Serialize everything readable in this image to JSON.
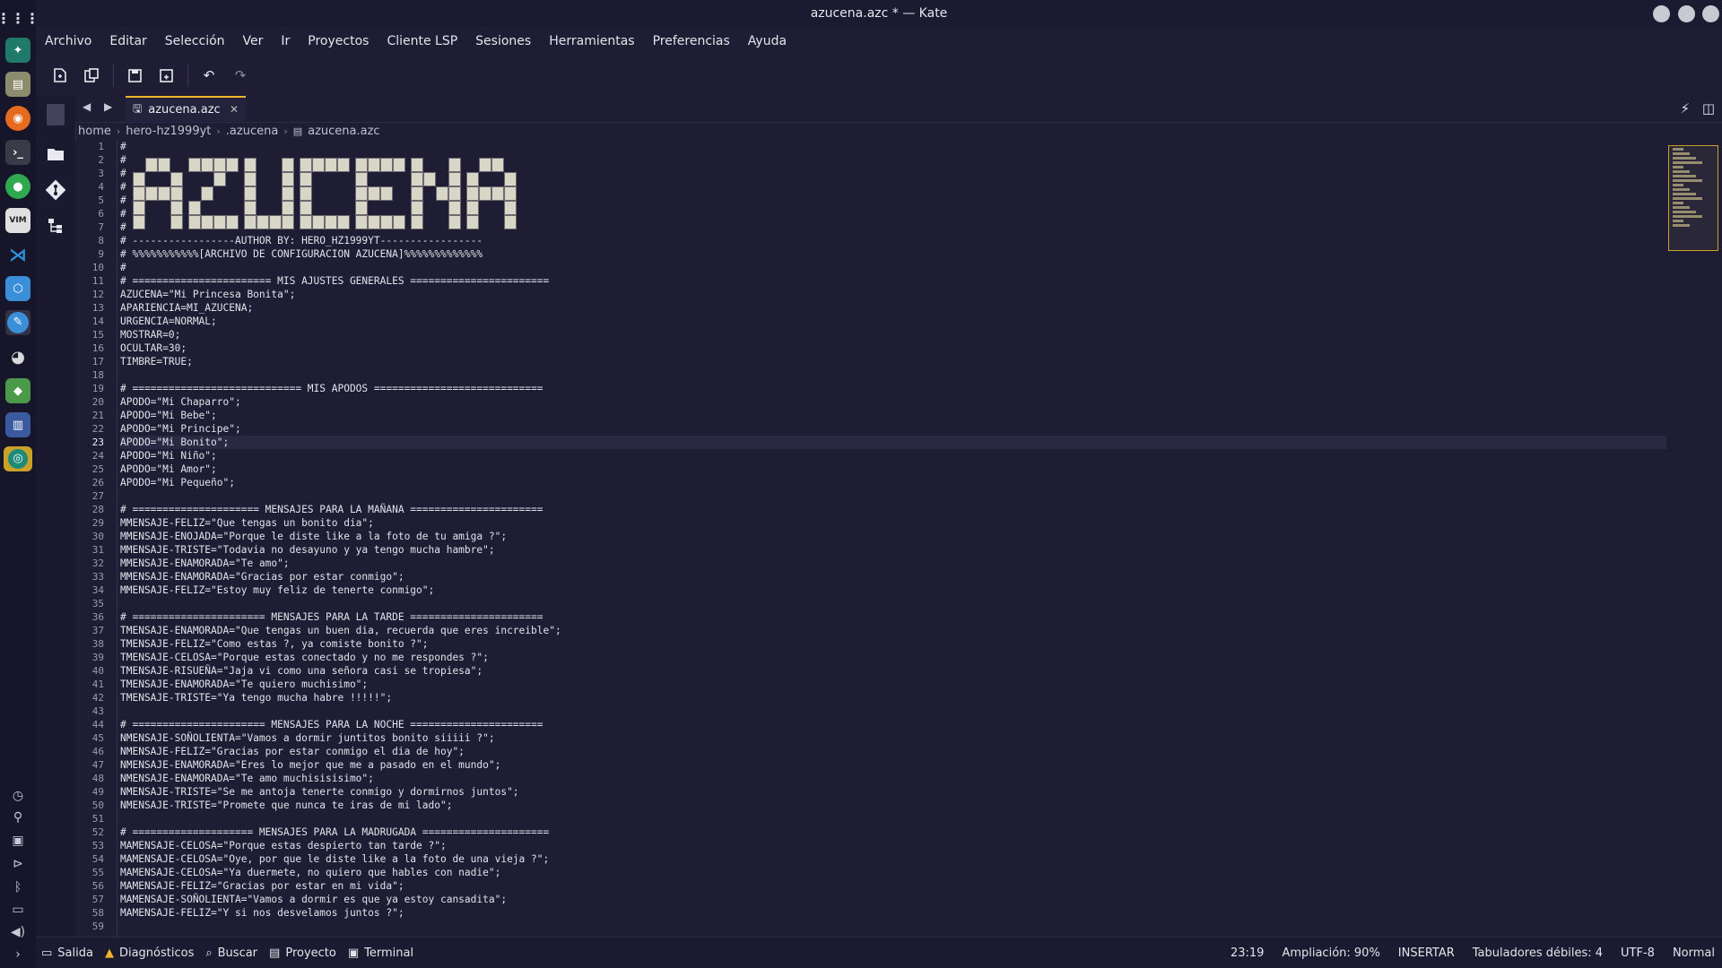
{
  "window": {
    "title": "azucena.azc * — Kate"
  },
  "menu": [
    "Archivo",
    "Editar",
    "Selección",
    "Ver",
    "Ir",
    "Proyectos",
    "Cliente LSP",
    "Sesiones",
    "Herramientas",
    "Preferencias",
    "Ayuda"
  ],
  "tab": {
    "label": "azucena.azc"
  },
  "breadcrumb": [
    "home",
    "hero-hz1999yt",
    ".azucena",
    "azucena.azc"
  ],
  "editor": {
    "current_line": 23,
    "ascii_art_word": "AZUCENA",
    "lines": [
      "#",
      "#",
      "#",
      "#",
      "#",
      "#",
      "#",
      "# -----------------AUTHOR BY: HERO_HZ1999YT-----------------",
      "# %%%%%%%%%%%[ARCHIVO DE CONFIGURACION AZUCENA]%%%%%%%%%%%%%",
      "#",
      "# ======================= MIS AJUSTES GENERALES =======================",
      "AZUCENA=\"Mi Princesa Bonita\";",
      "APARIENCIA=MI_AZUCENA;",
      "URGENCIA=NORMAL;",
      "MOSTRAR=0;",
      "OCULTAR=30;",
      "TIMBRE=TRUE;",
      "",
      "# ============================ MIS APODOS ============================",
      "APODO=\"Mi Chaparro\";",
      "APODO=\"Mi Bebe\";",
      "APODO=\"Mi Principe\";",
      "APODO=\"Mi Bonito\";",
      "APODO=\"Mi Niño\";",
      "APODO=\"Mi Amor\";",
      "APODO=\"Mi Pequeño\";",
      "",
      "# ===================== MENSAJES PARA LA MAÑANA ======================",
      "MMENSAJE-FELIZ=\"Que tengas un bonito dia\";",
      "MMENSAJE-ENOJADA=\"Porque le diste like a la foto de tu amiga ?\";",
      "MMENSAJE-TRISTE=\"Todavia no desayuno y ya tengo mucha hambre\";",
      "MMENSAJE-ENAMORADA=\"Te amo\";",
      "MMENSAJE-ENAMORADA=\"Gracias por estar conmigo\";",
      "MMENSAJE-FELIZ=\"Estoy muy feliz de tenerte conmigo\";",
      "",
      "# ====================== MENSAJES PARA LA TARDE ======================",
      "TMENSAJE-ENAMORADA=\"Que tengas un buen dia, recuerda que eres increible\";",
      "TMENSAJE-FELIZ=\"Como estas ?, ya comiste bonito ?\";",
      "TMENSAJE-CELOSA=\"Porque estas conectado y no me respondes ?\";",
      "TMENSAJE-RISUEÑA=\"Jaja vi como una señora casi se tropiesa\";",
      "TMENSAJE-ENAMORADA=\"Te quiero muchisimo\";",
      "TMENSAJE-TRISTE=\"Ya tengo mucha habre !!!!!\";",
      "",
      "# ====================== MENSAJES PARA LA NOCHE ======================",
      "NMENSAJE-SOÑOLIENTA=\"Vamos a dormir juntitos bonito siiiii ?\";",
      "NMENSAJE-FELIZ=\"Gracias por estar conmigo el dia de hoy\";",
      "NMENSAJE-ENAMORADA=\"Eres lo mejor que me a pasado en el mundo\";",
      "NMENSAJE-ENAMORADA=\"Te amo muchisisisimo\";",
      "NMENSAJE-TRISTE=\"Se me antoja tenerte conmigo y dormirnos juntos\";",
      "NMENSAJE-TRISTE=\"Promete que nunca te iras de mi lado\";",
      "",
      "# ==================== MENSAJES PARA LA MADRUGADA =====================",
      "MAMENSAJE-CELOSA=\"Porque estas despierto tan tarde ?\";",
      "MAMENSAJE-CELOSA=\"Oye, por que le diste like a la foto de una vieja ?\";",
      "MAMENSAJE-CELOSA=\"Ya duermete, no quiero que hables con nadie\";",
      "MAMENSAJE-FELIZ=\"Gracias por estar en mi vida\";",
      "MAMENSAJE-SOÑOLIENTA=\"Vamos a dormir es que ya estoy cansadita\";",
      "MAMENSAJE-FELIZ=\"Y si nos desvelamos juntos ?\";",
      ""
    ]
  },
  "statusbar": {
    "left": [
      "Salida",
      "Diagnósticos",
      "Buscar",
      "Proyecto",
      "Terminal"
    ],
    "position": "23:19",
    "zoom": "Ampliación: 90%",
    "mode": "INSERTAR",
    "tabs": "Tabuladores débiles: 4",
    "encoding": "UTF-8",
    "input_mode": "Normal"
  },
  "dock_apps": [
    "app-grid-icon",
    "kde-connect-icon",
    "files-icon",
    "firefox-icon",
    "terminal-icon",
    "music-player-icon",
    "vim-icon",
    "vscode-icon",
    "cube-app-icon",
    "kate-icon",
    "gimp-icon",
    "geogebra-icon",
    "document-app-icon",
    "android-studio-icon"
  ],
  "dock_tray": [
    "clock-icon",
    "pin-icon",
    "clipboard-icon",
    "media-play-icon",
    "bluetooth-icon",
    "monitor-icon",
    "volume-icon",
    "expand-icon"
  ],
  "colors": {
    "accent": "#f0b429",
    "background": "#1f1d33"
  }
}
